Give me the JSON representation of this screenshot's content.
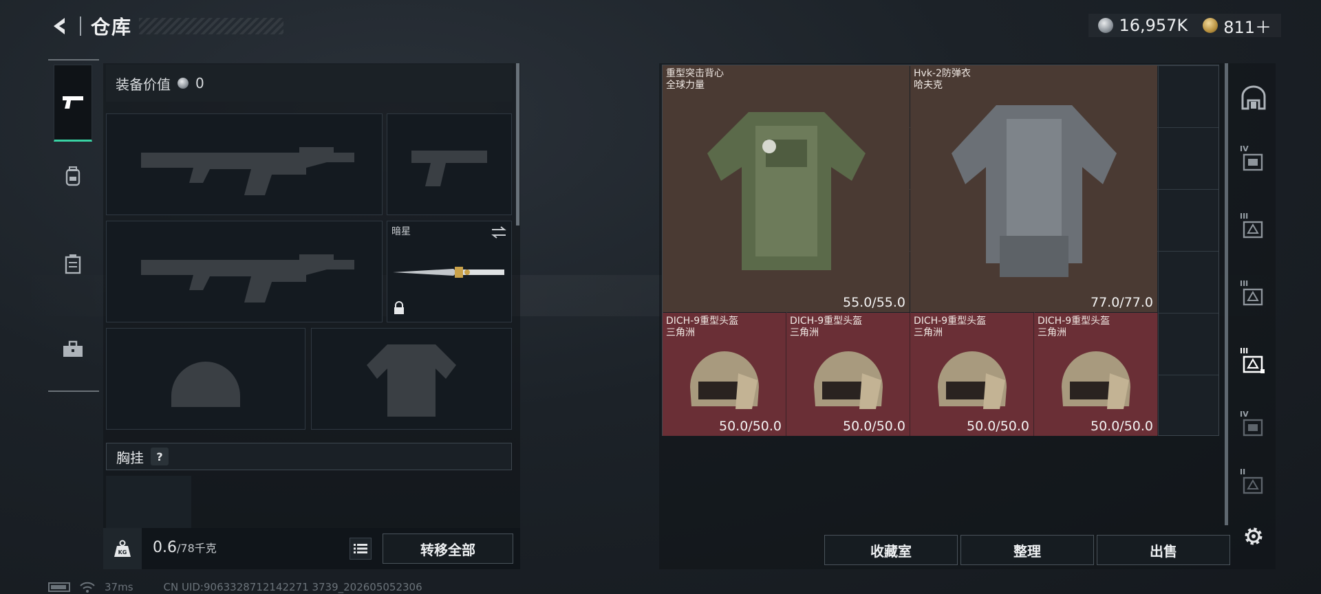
{
  "header": {
    "title": "仓库",
    "currency": [
      {
        "icon": "silver-coin-icon",
        "amount": "16,957K"
      },
      {
        "icon": "gold-coin-icon",
        "amount": "811＋"
      }
    ]
  },
  "left_tabs": [
    {
      "icon": "pistol-icon",
      "active": true
    },
    {
      "icon": "backpack-icon",
      "active": false
    },
    {
      "icon": "chest-rig-icon",
      "active": false
    },
    {
      "icon": "toolbox-icon",
      "active": false
    }
  ],
  "equipment": {
    "value_label": "装备价值",
    "value_amount": "0",
    "melee_slot_label": "暗星",
    "chest_rig_label": "胸挂",
    "help_mark": "?"
  },
  "weight": {
    "current": "0.6",
    "capacity": "/78千克"
  },
  "buttons": {
    "transfer_all": "转移全部",
    "collection": "收藏室",
    "organize": "整理",
    "sell": "出售"
  },
  "storage_items": [
    {
      "name": "重型突击背心",
      "sub": "全球力量",
      "durability": "55.0/55.0",
      "kind": "vest"
    },
    {
      "name": "Hvk-2防弹衣",
      "sub": "哈夫克",
      "durability": "77.0/77.0",
      "kind": "vest"
    },
    {
      "name": "DICH-9重型头盔",
      "sub": "三角洲",
      "durability": "50.0/50.0",
      "kind": "helmet"
    },
    {
      "name": "DICH-9重型头盔",
      "sub": "三角洲",
      "durability": "50.0/50.0",
      "kind": "helmet"
    },
    {
      "name": "DICH-9重型头盔",
      "sub": "三角洲",
      "durability": "50.0/50.0",
      "kind": "helmet"
    },
    {
      "name": "DICH-9重型头盔",
      "sub": "三角洲",
      "durability": "50.0/50.0",
      "kind": "helmet"
    }
  ],
  "right_tabs": [
    {
      "icon": "shelter-icon",
      "label": ""
    },
    {
      "icon": "storage-tier-icon",
      "label": "IV"
    },
    {
      "icon": "storage-tier-icon",
      "label": "III"
    },
    {
      "icon": "storage-tier-icon",
      "label": "III"
    },
    {
      "icon": "storage-tier-icon",
      "label": "III",
      "active": true
    },
    {
      "icon": "storage-tier-icon",
      "label": "IV"
    },
    {
      "icon": "storage-tier-icon",
      "label": "II"
    },
    {
      "icon": "gear-icon",
      "label": ""
    }
  ],
  "status": {
    "ping": "37ms",
    "uid": "CN UID:9063328712142271 3739_202605052306"
  },
  "colors": {
    "active_accent": "#39d3a4",
    "vest_bg": "#4a3a33",
    "helmet_bg": "#6a2f36"
  }
}
